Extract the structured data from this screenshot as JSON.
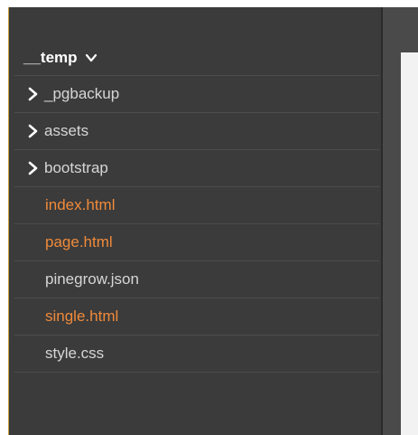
{
  "project": {
    "title": "__temp",
    "expand_icon": "chevron-down-icon"
  },
  "tree": {
    "folders": [
      {
        "label": "_pgbackup",
        "icon": "chevron-right-icon"
      },
      {
        "label": "assets",
        "icon": "chevron-right-icon"
      },
      {
        "label": "bootstrap",
        "icon": "chevron-right-icon"
      }
    ],
    "files": [
      {
        "label": "index.html",
        "color": "#f08a3a"
      },
      {
        "label": "page.html",
        "color": "#f08a3a"
      },
      {
        "label": "pinegrow.json",
        "color": "#d6d6d6"
      },
      {
        "label": "single.html",
        "color": "#f08a3a"
      },
      {
        "label": "style.css",
        "color": "#d6d6d6"
      }
    ]
  },
  "colors": {
    "panel_bg": "#3b3b3b",
    "html_file": "#f08a3a",
    "plain_file": "#d6d6d6",
    "accent_border": "#c8a23a"
  }
}
